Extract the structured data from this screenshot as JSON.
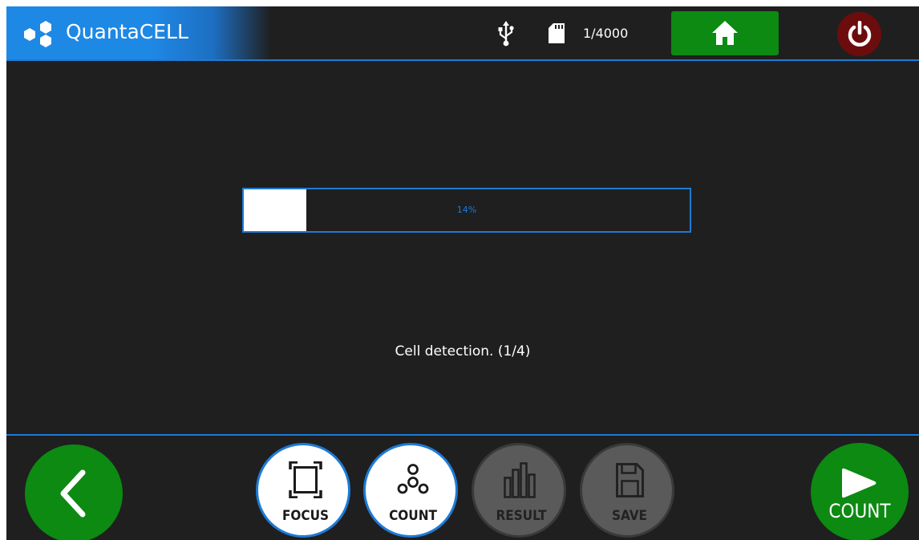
{
  "header": {
    "app_title": "QuantaCELL",
    "logo_icon": "hexagon-cluster-logo",
    "usb_icon": "usb-icon",
    "sd_icon": "sd-card-icon",
    "count_indicator": "1/4000",
    "home_icon": "home-icon",
    "power_icon": "power-icon"
  },
  "progress": {
    "percent": 14,
    "label": "14%"
  },
  "status": {
    "text": "Cell detection. (1/4)"
  },
  "footer": {
    "back_icon": "chevron-left-icon",
    "tools": [
      {
        "label": "FOCUS",
        "icon": "focus-frame-icon",
        "state": "active"
      },
      {
        "label": "COUNT",
        "icon": "cells-icon",
        "state": "active"
      },
      {
        "label": "RESULT",
        "icon": "bar-chart-icon",
        "state": "inactive"
      },
      {
        "label": "SAVE",
        "icon": "floppy-disk-icon",
        "state": "inactive"
      }
    ],
    "start_button_label": "COUNT",
    "start_icon": "play-icon"
  },
  "colors": {
    "background": "#1f1f1f",
    "accent_blue": "#1e7bd6",
    "green": "#0c8a12",
    "power_red": "#6d0c0c",
    "inactive_gray": "#5a5a5a"
  }
}
